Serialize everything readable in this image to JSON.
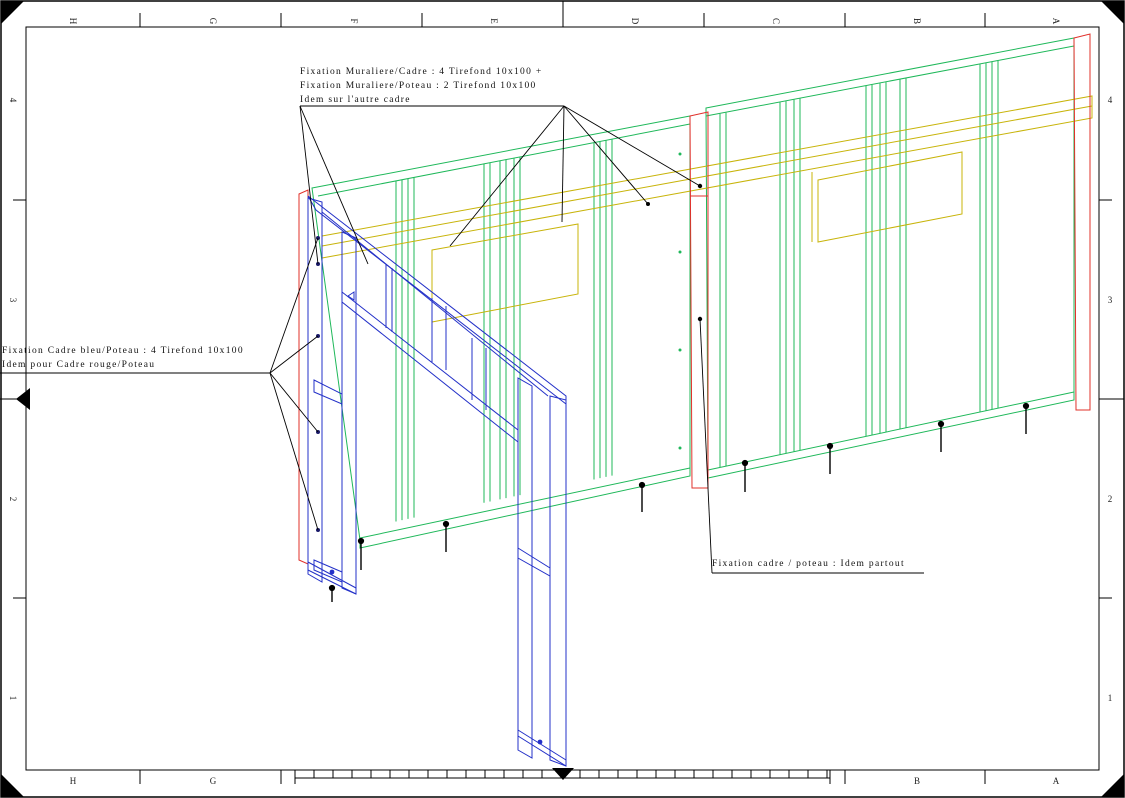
{
  "sheet": {
    "columns": [
      "H",
      "G",
      "F",
      "E",
      "D",
      "C",
      "B",
      "A"
    ],
    "rows": [
      "4",
      "3",
      "2",
      "1"
    ]
  },
  "annotations": {
    "wall_fixing": [
      "Fixation Muraliere/Cadre : 4 Tirefond 10x100 +",
      "Fixation Muraliere/Poteau : 2 Tirefond 10x100",
      "Idem sur l'autre cadre"
    ],
    "blue_frame_fixing": [
      "Fixation Cadre bleu/Poteau : 4 Tirefond 10x100",
      "Idem pour Cadre rouge/Poteau"
    ],
    "frame_post_fixing": "Fixation cadre / poteau : Idem partout"
  },
  "colors": {
    "frame_green": "#1fb85a",
    "post_red": "#e0302a",
    "beam_yellow": "#c8b40a",
    "frame_blue": "#2330c8",
    "leader": "#000000"
  }
}
